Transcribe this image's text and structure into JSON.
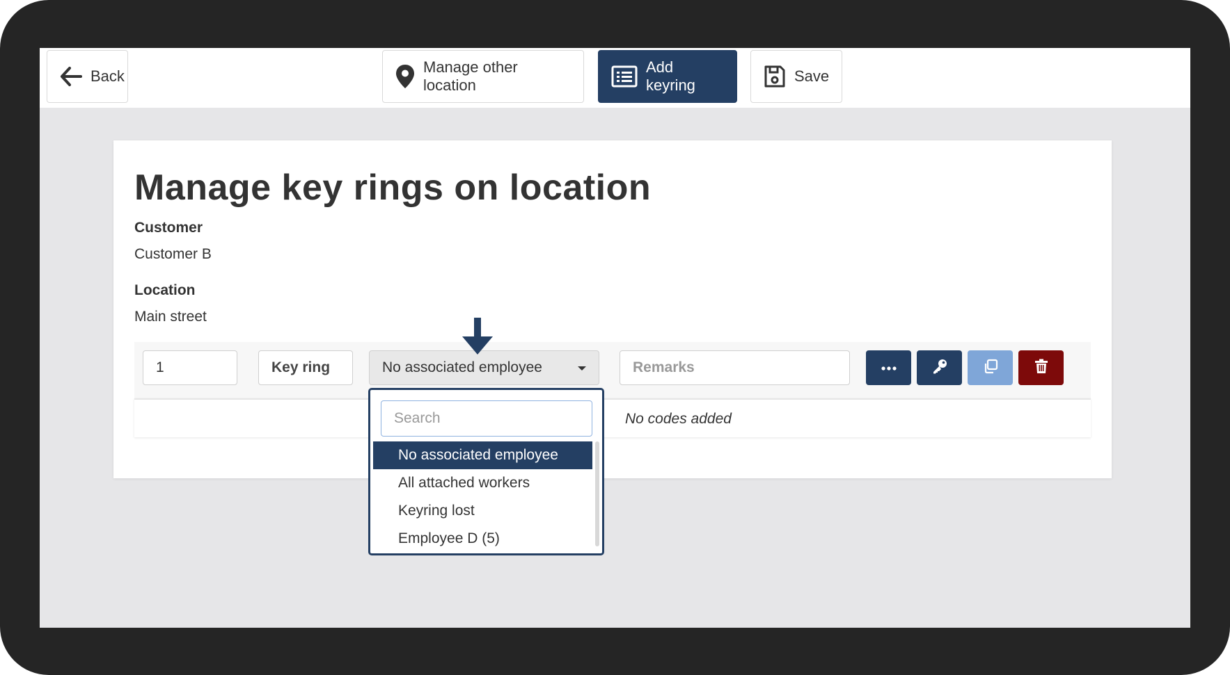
{
  "toolbar": {
    "back_label": "Back",
    "manage_other_location_label": "Manage other location",
    "add_keyring_label": "Add keyring",
    "save_label": "Save"
  },
  "page": {
    "title": "Manage key rings on location",
    "customer_label": "Customer",
    "customer_value": "Customer B",
    "location_label": "Location",
    "location_value": "Main street"
  },
  "keyring_row": {
    "number_value": "1",
    "name_value": "Key ring",
    "employee_selected": "No associated employee",
    "remarks_placeholder": "Remarks",
    "codes_text": "No codes added"
  },
  "dropdown": {
    "search_placeholder": "Search",
    "options": [
      "No associated employee",
      "All attached workers",
      "Keyring lost",
      "Employee D (5)"
    ],
    "selected_index": 0
  },
  "colors": {
    "primary": "#243f63",
    "copy_button": "#7fa6d8",
    "delete_button": "#7d0a0a",
    "frame": "#252525",
    "background": "#e6e6e8"
  },
  "icons": {
    "back": "arrow-left-icon",
    "location": "map-pin-icon",
    "add_keyring": "list-icon",
    "save": "floppy-disk-icon",
    "more": "ellipsis-icon",
    "key": "key-icon",
    "copy": "copy-icon",
    "delete": "trash-icon",
    "dropdown_caret": "caret-down-icon",
    "annotation": "arrow-down-icon"
  }
}
